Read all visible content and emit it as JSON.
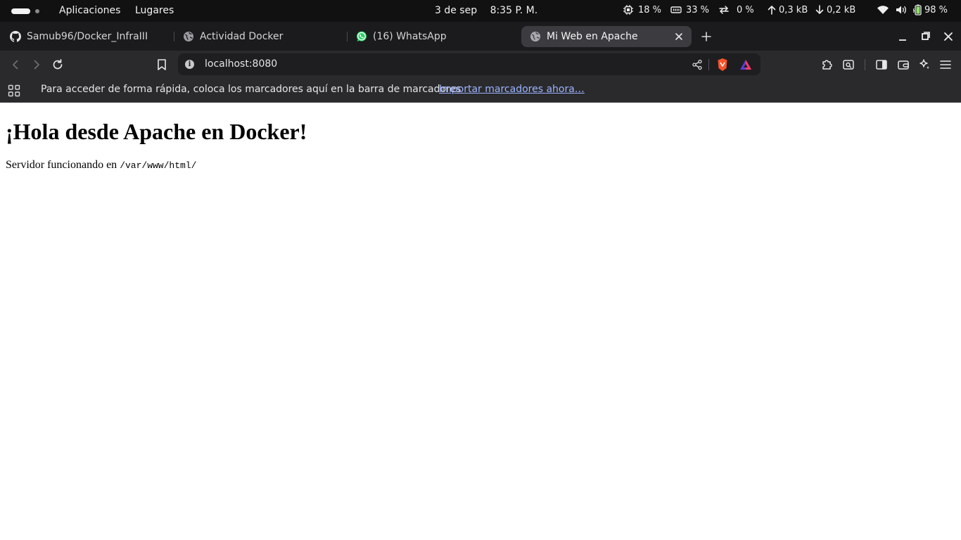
{
  "system_bar": {
    "menu": [
      "Aplicaciones",
      "Lugares"
    ],
    "date": "3 de sep",
    "time": "8:35 P. M.",
    "cpu": "18 %",
    "memory": "33 %",
    "swap": "0 %",
    "net_up": "0,3 kB",
    "net_down": "0,2 kB",
    "battery": "98 %"
  },
  "tabs": [
    {
      "label": "Samub96/Docker_InfraIII",
      "icon": "github-icon"
    },
    {
      "label": "Actividad Docker",
      "icon": "globe-icon"
    },
    {
      "label": "(16) WhatsApp",
      "icon": "whatsapp-icon"
    },
    {
      "label": "Mi Web en Apache",
      "icon": "globe-icon",
      "active": true
    }
  ],
  "address_bar": {
    "url": "localhost:8080",
    "info_glyph": "i"
  },
  "bookmarks_bar": {
    "hint": "Para acceder de forma rápida, coloca los marcadores aquí en la barra de marcadores",
    "import_link": "Importar marcadores ahora…"
  },
  "page": {
    "heading": "¡Hola desde Apache en Docker!",
    "text_prefix": "Servidor funcionando en",
    "path": "/var/www/html/"
  },
  "colors": {
    "brave_orange": "#fb542b",
    "whatsapp_green": "#25d366",
    "link_blue": "#9cb4ff"
  }
}
